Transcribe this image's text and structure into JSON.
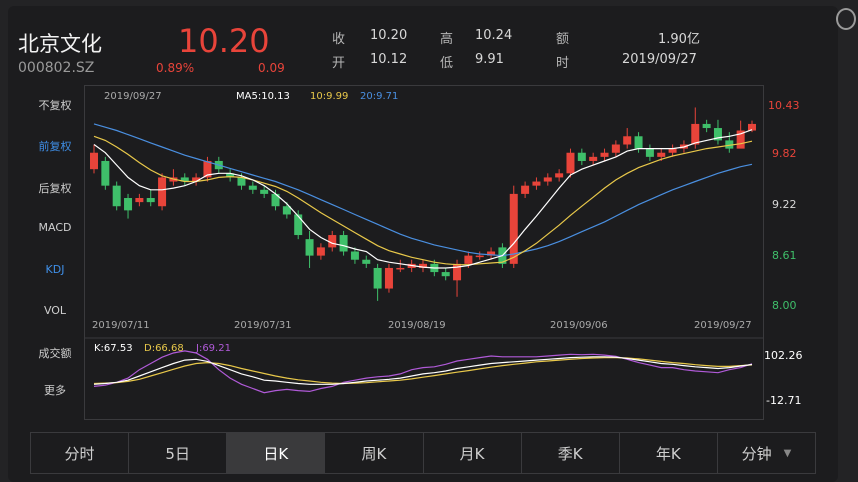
{
  "stock": {
    "name": "北京文化",
    "code": "000802.SZ",
    "price": "10.20",
    "change_pct": "0.89%",
    "change": "0.09"
  },
  "quote": {
    "open_close": [
      {
        "label": "收",
        "value": "10.20"
      },
      {
        "label": "开",
        "value": "10.12"
      }
    ],
    "high_low": [
      {
        "label": "高",
        "value": "10.24"
      },
      {
        "label": "低",
        "value": "9.91"
      }
    ],
    "amount": {
      "label": "额",
      "value": "1.90亿"
    },
    "time": {
      "label": "时",
      "value": "2019/09/27"
    }
  },
  "side_menu": [
    "不复权",
    "前复权",
    "后复权",
    "MACD",
    "KDJ",
    "VOL",
    "成交额",
    "更多"
  ],
  "side_active": 1,
  "side_active2": 4,
  "ma_legend": {
    "date": "2019/09/27",
    "ma5": "MA5:10.13",
    "ma10": "10:9.99",
    "ma20": "20:9.71"
  },
  "kdj_legend": {
    "k": "K:67.53",
    "d": "D:66.68",
    "j": "J:69.21"
  },
  "price_axis": [
    "10.43",
    "9.82",
    "9.22",
    "8.61",
    "8.00"
  ],
  "kdj_axis": [
    "102.26",
    "-12.71"
  ],
  "dates": [
    "2019/07/11",
    "2019/07/31",
    "2019/08/19",
    "2019/09/06",
    "2019/09/27"
  ],
  "tabs": [
    "分时",
    "5日",
    "日K",
    "周K",
    "月K",
    "季K",
    "年K",
    "分钟"
  ],
  "active_tab": 2,
  "colors": {
    "up": "#e8443a",
    "down": "#3fbf6a",
    "ma5": "#ffffff",
    "ma10": "#e8c84a",
    "ma20": "#4a8fe0",
    "j": "#b05ad8"
  },
  "chart_data": {
    "type": "candlestick",
    "ylim": [
      8.0,
      10.43
    ],
    "candles": [
      [
        9.65,
        9.85,
        9.95,
        9.6
      ],
      [
        9.75,
        9.45,
        9.8,
        9.4
      ],
      [
        9.45,
        9.2,
        9.5,
        9.15
      ],
      [
        9.3,
        9.15,
        9.35,
        9.05
      ],
      [
        9.25,
        9.3,
        9.35,
        9.2
      ],
      [
        9.3,
        9.25,
        9.4,
        9.2
      ],
      [
        9.2,
        9.55,
        9.6,
        9.15
      ],
      [
        9.5,
        9.55,
        9.65,
        9.45
      ],
      [
        9.55,
        9.5,
        9.6,
        9.45
      ],
      [
        9.5,
        9.55,
        9.6,
        9.45
      ],
      [
        9.55,
        9.75,
        9.8,
        9.5
      ],
      [
        9.75,
        9.65,
        9.8,
        9.6
      ],
      [
        9.6,
        9.55,
        9.65,
        9.5
      ],
      [
        9.55,
        9.45,
        9.6,
        9.4
      ],
      [
        9.45,
        9.4,
        9.5,
        9.35
      ],
      [
        9.4,
        9.35,
        9.45,
        9.3
      ],
      [
        9.35,
        9.2,
        9.4,
        9.15
      ],
      [
        9.2,
        9.1,
        9.25,
        9.05
      ],
      [
        9.1,
        8.85,
        9.15,
        8.8
      ],
      [
        8.8,
        8.6,
        8.9,
        8.45
      ],
      [
        8.6,
        8.7,
        8.75,
        8.55
      ],
      [
        8.7,
        8.85,
        8.9,
        8.65
      ],
      [
        8.85,
        8.65,
        8.9,
        8.6
      ],
      [
        8.65,
        8.55,
        8.7,
        8.5
      ],
      [
        8.55,
        8.5,
        8.6,
        8.45
      ],
      [
        8.45,
        8.2,
        8.5,
        8.05
      ],
      [
        8.2,
        8.45,
        8.5,
        8.15
      ],
      [
        8.45,
        8.45,
        8.55,
        8.4
      ],
      [
        8.45,
        8.5,
        8.55,
        8.4
      ],
      [
        8.45,
        8.5,
        8.55,
        8.4
      ],
      [
        8.5,
        8.4,
        8.55,
        8.35
      ],
      [
        8.4,
        8.35,
        8.45,
        8.3
      ],
      [
        8.3,
        8.5,
        8.55,
        8.1
      ],
      [
        8.5,
        8.6,
        8.65,
        8.45
      ],
      [
        8.6,
        8.6,
        8.65,
        8.55
      ],
      [
        8.6,
        8.65,
        8.7,
        8.55
      ],
      [
        8.7,
        8.5,
        8.75,
        8.45
      ],
      [
        8.5,
        9.35,
        9.45,
        8.45
      ],
      [
        9.35,
        9.45,
        9.5,
        9.3
      ],
      [
        9.45,
        9.5,
        9.55,
        9.4
      ],
      [
        9.5,
        9.55,
        9.6,
        9.45
      ],
      [
        9.55,
        9.6,
        9.65,
        9.5
      ],
      [
        9.6,
        9.85,
        9.9,
        9.55
      ],
      [
        9.85,
        9.75,
        9.9,
        9.7
      ],
      [
        9.75,
        9.8,
        9.85,
        9.7
      ],
      [
        9.8,
        9.85,
        9.9,
        9.75
      ],
      [
        9.85,
        9.95,
        10.0,
        9.8
      ],
      [
        9.95,
        10.05,
        10.15,
        9.9
      ],
      [
        10.05,
        9.9,
        10.1,
        9.85
      ],
      [
        9.9,
        9.8,
        9.95,
        9.75
      ],
      [
        9.8,
        9.85,
        9.9,
        9.75
      ],
      [
        9.85,
        9.9,
        9.95,
        9.8
      ],
      [
        9.9,
        9.95,
        10.0,
        9.85
      ],
      [
        9.95,
        10.2,
        10.4,
        9.9
      ],
      [
        10.2,
        10.15,
        10.25,
        10.1
      ],
      [
        10.15,
        10.0,
        10.25,
        9.95
      ],
      [
        10.0,
        9.9,
        10.1,
        9.85
      ],
      [
        9.9,
        10.12,
        10.24,
        9.91
      ],
      [
        10.12,
        10.2,
        10.24,
        10.1
      ]
    ],
    "ma5": [
      9.95,
      9.85,
      9.7,
      9.55,
      9.45,
      9.4,
      9.4,
      9.42,
      9.45,
      9.5,
      9.58,
      9.6,
      9.6,
      9.57,
      9.52,
      9.45,
      9.35,
      9.23,
      9.08,
      8.92,
      8.82,
      8.75,
      8.72,
      8.68,
      8.65,
      8.55,
      8.52,
      8.5,
      8.48,
      8.46,
      8.45,
      8.45,
      8.46,
      8.48,
      8.52,
      8.56,
      8.6,
      8.75,
      8.92,
      9.08,
      9.25,
      9.42,
      9.58,
      9.65,
      9.7,
      9.75,
      9.8,
      9.87,
      9.9,
      9.9,
      9.9,
      9.9,
      9.92,
      9.97,
      10.0,
      10.03,
      10.05,
      10.08,
      10.13
    ],
    "ma10": [
      10.05,
      10.0,
      9.92,
      9.83,
      9.73,
      9.64,
      9.57,
      9.53,
      9.5,
      9.5,
      9.52,
      9.55,
      9.56,
      9.55,
      9.52,
      9.48,
      9.44,
      9.38,
      9.3,
      9.21,
      9.12,
      9.04,
      8.96,
      8.88,
      8.8,
      8.72,
      8.66,
      8.62,
      8.58,
      8.55,
      8.52,
      8.5,
      8.49,
      8.49,
      8.5,
      8.51,
      8.52,
      8.58,
      8.66,
      8.75,
      8.86,
      8.97,
      9.09,
      9.2,
      9.31,
      9.42,
      9.52,
      9.6,
      9.67,
      9.72,
      9.77,
      9.81,
      9.84,
      9.87,
      9.9,
      9.92,
      9.94,
      9.96,
      9.99
    ],
    "ma20": [
      10.2,
      10.16,
      10.12,
      10.07,
      10.02,
      9.97,
      9.92,
      9.87,
      9.82,
      9.78,
      9.74,
      9.7,
      9.66,
      9.62,
      9.58,
      9.54,
      9.5,
      9.45,
      9.4,
      9.34,
      9.28,
      9.22,
      9.16,
      9.1,
      9.04,
      8.98,
      8.92,
      8.86,
      8.81,
      8.77,
      8.73,
      8.7,
      8.67,
      8.64,
      8.62,
      8.61,
      8.6,
      8.62,
      8.65,
      8.68,
      8.72,
      8.77,
      8.83,
      8.89,
      8.95,
      9.01,
      9.08,
      9.15,
      9.22,
      9.28,
      9.34,
      9.4,
      9.45,
      9.5,
      9.55,
      9.6,
      9.64,
      9.68,
      9.71
    ],
    "kdj_ylim": [
      -12.71,
      102.26
    ],
    "k": [
      20,
      22,
      25,
      30,
      40,
      50,
      60,
      70,
      78,
      80,
      75,
      65,
      55,
      45,
      38,
      30,
      28,
      25,
      22,
      20,
      20,
      20,
      22,
      25,
      28,
      30,
      32,
      35,
      40,
      45,
      48,
      52,
      58,
      62,
      66,
      70,
      72,
      74,
      76,
      78,
      80,
      82,
      84,
      85,
      86,
      86,
      85,
      82,
      78,
      74,
      70,
      68,
      65,
      62,
      60,
      58,
      60,
      64,
      67.53
    ],
    "d": [
      22,
      23,
      24,
      27,
      32,
      40,
      48,
      56,
      64,
      70,
      72,
      70,
      65,
      58,
      52,
      46,
      40,
      35,
      31,
      28,
      25,
      23,
      22,
      23,
      24,
      26,
      28,
      30,
      33,
      37,
      41,
      45,
      49,
      53,
      57,
      61,
      65,
      68,
      71,
      74,
      76,
      78,
      80,
      82,
      83,
      84,
      84,
      83,
      81,
      78,
      75,
      72,
      70,
      67,
      65,
      63,
      63,
      65,
      66.68
    ],
    "j": [
      15,
      18,
      25,
      35,
      55,
      70,
      85,
      95,
      100,
      95,
      80,
      55,
      35,
      20,
      10,
      0,
      5,
      8,
      5,
      3,
      10,
      15,
      25,
      30,
      35,
      38,
      40,
      45,
      55,
      60,
      62,
      68,
      76,
      80,
      84,
      88,
      86,
      86,
      86,
      86,
      88,
      90,
      92,
      91,
      92,
      90,
      87,
      80,
      72,
      66,
      60,
      60,
      55,
      52,
      50,
      48,
      55,
      60,
      69.21
    ]
  }
}
